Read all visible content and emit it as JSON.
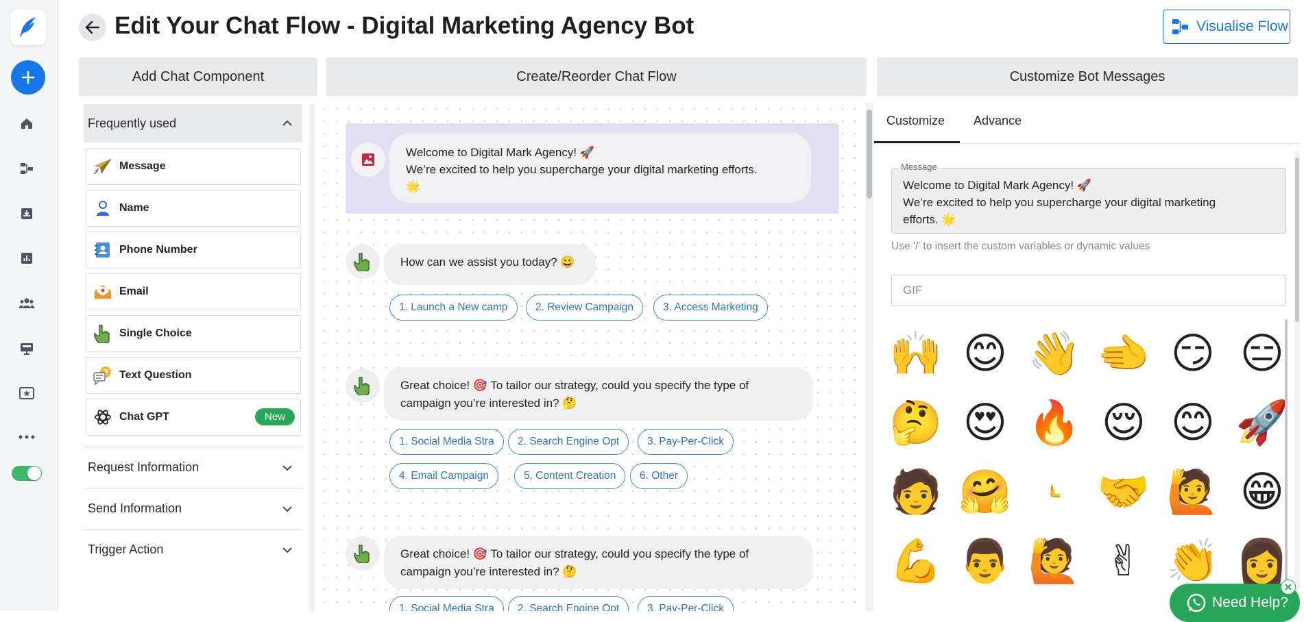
{
  "header": {
    "title": "Edit Your Chat Flow - Digital Marketing Agency Bot",
    "visualise_label": "Visualise Flow"
  },
  "columns": {
    "add": "Add Chat Component",
    "create": "Create/Reorder Chat Flow",
    "customize": "Customize Bot Messages"
  },
  "components": {
    "section_title": "Frequently used",
    "items": [
      {
        "label": "Message",
        "icon": "paper-plane-icon"
      },
      {
        "label": "Name",
        "icon": "person-icon"
      },
      {
        "label": "Phone Number",
        "icon": "contact-card-icon"
      },
      {
        "label": "Email",
        "icon": "envelope-icon"
      },
      {
        "label": "Single Choice",
        "icon": "pointing-hand-icon"
      },
      {
        "label": "Text Question",
        "icon": "question-bubble-icon"
      },
      {
        "label": "Chat GPT",
        "icon": "openai-icon",
        "badge": "New"
      }
    ],
    "collapsed_sections": [
      "Request Information",
      "Send Information",
      "Trigger Action"
    ]
  },
  "flow": {
    "welcome": {
      "line1": "Welcome to Digital Mark Agency! 🚀",
      "line2": "We’re excited to help you supercharge your digital marketing efforts.",
      "line3": "🌟"
    },
    "assist": {
      "question": "How can we assist you today? 😀",
      "options": [
        "1. Launch a New camp",
        "2. Review Campaign",
        "3. Access Marketing"
      ]
    },
    "campaign1": {
      "line1": "Great choice! 🎯 To tailor our strategy, could you specify the type of",
      "line2": "campaign you’re interested in? 🤔",
      "options": [
        "1. Social Media Stra",
        "2. Search Engine Opt",
        "3. Pay-Per-Click",
        "4. Email Campaign",
        "5. Content Creation",
        "6. Other"
      ]
    },
    "campaign2": {
      "line1": "Great choice! 🎯 To tailor our strategy, could you specify the type of",
      "line2": "campaign you’re interested in? 🤔",
      "options": [
        "1. Social Media Stra",
        "2. Search Engine Opt",
        "3. Pay-Per-Click"
      ]
    }
  },
  "customize": {
    "tabs": [
      "Customize",
      "Advance"
    ],
    "active_tab": "Customize",
    "message_legend": "Message",
    "message_line1": "Welcome to Digital Mark Agency! 🚀",
    "message_line2": "We’re excited to help you supercharge your digital marketing",
    "message_line3": "efforts. 🌟",
    "hint": "Use '/' to insert the custom variables or dynamic values",
    "gif_placeholder": "GIF",
    "emojis": [
      "🙌",
      "😊",
      "👋",
      "🫲",
      "😏",
      "😑",
      "🤔",
      "😍",
      "🔥",
      "😌",
      "😊",
      "🚀",
      "🧑",
      "🤗",
      "🫷",
      "🤝",
      "🙋",
      "😁",
      "💪",
      "👨",
      "🙋",
      "✌",
      "👏",
      "👩"
    ]
  },
  "help": {
    "label": "Need Help?"
  },
  "colors": {
    "accent": "#1877e6",
    "chip": "#2a75c4",
    "welcome_card": "#e3dff2",
    "help_green": "#29a65a",
    "new_badge": "#2aa65a"
  }
}
